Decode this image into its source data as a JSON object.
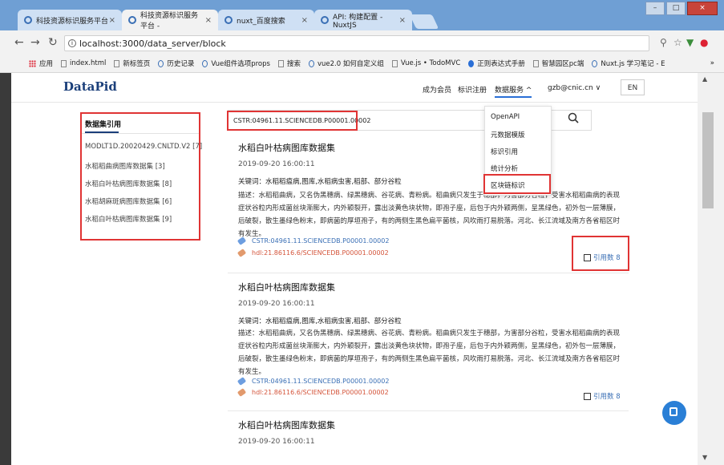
{
  "browser": {
    "tabs": [
      {
        "title": "科技资源标识服务平台"
      },
      {
        "title": "科技资源标识服务平台 -"
      },
      {
        "title": "nuxt_百度搜索"
      },
      {
        "title": "API: 构建配置 - NuxtJS"
      }
    ],
    "tab_close": "×",
    "url": "localhost:3000/data_server/block",
    "bookmarks": [
      "应用",
      "index.html",
      "新标签页",
      "历史记录",
      "Vue组件选项props",
      "搜索",
      "vue2.0 如何自定义组",
      "Vue.js • TodoMVC",
      "正则表达式手册",
      "智慧园区pc端",
      "Nuxt.js 学习笔记 - E"
    ],
    "bookmarks_more": "»"
  },
  "site": {
    "logo": "DataPid",
    "nav": [
      "成为会员",
      "标识注册",
      "数据服务 ^",
      "gzb@cnic.cn ∨"
    ],
    "lang": "EN"
  },
  "left_panel": {
    "title": "数据集引用",
    "items": [
      "MODLT1D.20020429.CNLTD.V2 [7]",
      "水稻稻曲病图库数据集 [3]",
      "水稻白叶枯病图库数据集 [8]",
      "水稻胡麻斑病图库数据集 [6]",
      "水稻白叶枯病图库数据集 [9]"
    ]
  },
  "search": {
    "value": "CSTR:04961.11.SCIENCEDB.P00001.00002"
  },
  "dropdown": {
    "items": [
      "OpenAPI",
      "元数据模版",
      "标识引用",
      "统计分析",
      "区块链标识"
    ]
  },
  "results": [
    {
      "title": "水稻白叶枯病图库数据集",
      "date": "2019-09-20 16:00:11",
      "keywords": "关键词：水稻稻瘟病,图库,水稻病虫害,稻部、部分谷粒",
      "desc": "描述：水稻稻曲病，又名伪黑穗病、绿黑穗病、谷花病、青粉病。稻曲病只发生于穗部，为害部分谷粒，受害水稻稻曲病的表现症状谷粒内形成菌丝块渐膨大，内外颖裂开，露出淡黄色块状物，即孢子座，后包于内外颖两侧，呈黑绿色，初外包一层薄膜，后破裂，散生墨绿色粉末，即病菌的厚垣孢子，有的两侧生黑色扁平菌核，风吹雨打易脱落。河北、长江流域及南方各省稻区时有发生。",
      "cstr": "CSTR:04961.11.SCIENCEDB.P00001.00002",
      "hdl": "hdl:21.86116.6/SCIENCEDB.P00001.00002",
      "cite": "引用数 8"
    },
    {
      "title": "水稻白叶枯病图库数据集",
      "date": "2019-09-20 16:00:11",
      "keywords": "关键词：水稻稻瘟病,图库,水稻病虫害,稻部、部分谷粒",
      "desc": "描述：水稻稻曲病，又名伪黑穗病、绿黑穗病、谷花病、青粉病。稻曲病只发生于穗部，为害部分谷粒，受害水稻稻曲病的表现症状谷粒内形成菌丝块渐膨大，内外颖裂开，露出淡黄色块状物，即孢子座，后包于内外颖两侧，呈黑绿色，初外包一层薄膜，后破裂，散生墨绿色粉末，即病菌的厚垣孢子，有的两侧生黑色扁平菌核，风吹雨打易脱落。河北、长江流域及南方各省稻区时有发生。",
      "cstr": "CSTR:04961.11.SCIENCEDB.P00001.00002",
      "hdl": "hdl:21.86116.6/SCIENCEDB.P00001.00002",
      "cite": "引用数 8"
    },
    {
      "title": "水稻白叶枯病图库数据集",
      "date": "2019-09-20 16:00:11"
    }
  ],
  "colors": {
    "accent": "#2a6fd6",
    "highlight_box": "#e03434",
    "cstr": "#3a6fb5",
    "hdl": "#d4543a"
  }
}
